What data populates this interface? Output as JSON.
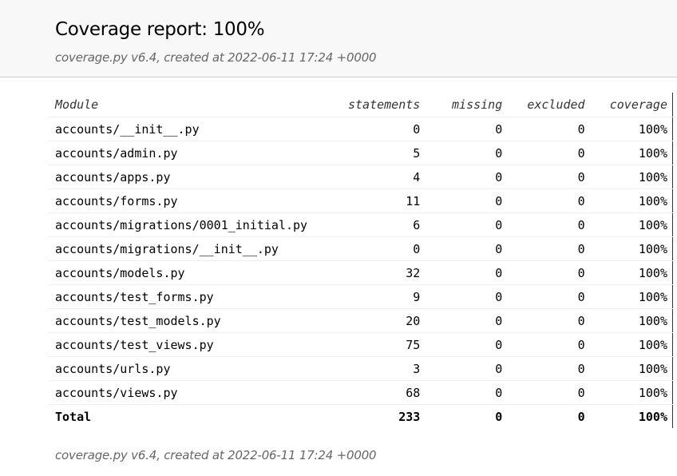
{
  "header": {
    "title": "Coverage report: 100%",
    "subtitle": "coverage.py v6.4, created at 2022-06-11 17:24 +0000"
  },
  "table": {
    "columns": [
      "Module",
      "statements",
      "missing",
      "excluded",
      "coverage"
    ],
    "rows": [
      {
        "module": "accounts/__init__.py",
        "statements": "0",
        "missing": "0",
        "excluded": "0",
        "coverage": "100%"
      },
      {
        "module": "accounts/admin.py",
        "statements": "5",
        "missing": "0",
        "excluded": "0",
        "coverage": "100%"
      },
      {
        "module": "accounts/apps.py",
        "statements": "4",
        "missing": "0",
        "excluded": "0",
        "coverage": "100%"
      },
      {
        "module": "accounts/forms.py",
        "statements": "11",
        "missing": "0",
        "excluded": "0",
        "coverage": "100%"
      },
      {
        "module": "accounts/migrations/0001_initial.py",
        "statements": "6",
        "missing": "0",
        "excluded": "0",
        "coverage": "100%"
      },
      {
        "module": "accounts/migrations/__init__.py",
        "statements": "0",
        "missing": "0",
        "excluded": "0",
        "coverage": "100%"
      },
      {
        "module": "accounts/models.py",
        "statements": "32",
        "missing": "0",
        "excluded": "0",
        "coverage": "100%"
      },
      {
        "module": "accounts/test_forms.py",
        "statements": "9",
        "missing": "0",
        "excluded": "0",
        "coverage": "100%"
      },
      {
        "module": "accounts/test_models.py",
        "statements": "20",
        "missing": "0",
        "excluded": "0",
        "coverage": "100%"
      },
      {
        "module": "accounts/test_views.py",
        "statements": "75",
        "missing": "0",
        "excluded": "0",
        "coverage": "100%"
      },
      {
        "module": "accounts/urls.py",
        "statements": "3",
        "missing": "0",
        "excluded": "0",
        "coverage": "100%"
      },
      {
        "module": "accounts/views.py",
        "statements": "68",
        "missing": "0",
        "excluded": "0",
        "coverage": "100%"
      }
    ],
    "total": {
      "module": "Total",
      "statements": "233",
      "missing": "0",
      "excluded": "0",
      "coverage": "100%"
    }
  },
  "footer": {
    "text": "coverage.py v6.4, created at 2022-06-11 17:24 +0000"
  }
}
